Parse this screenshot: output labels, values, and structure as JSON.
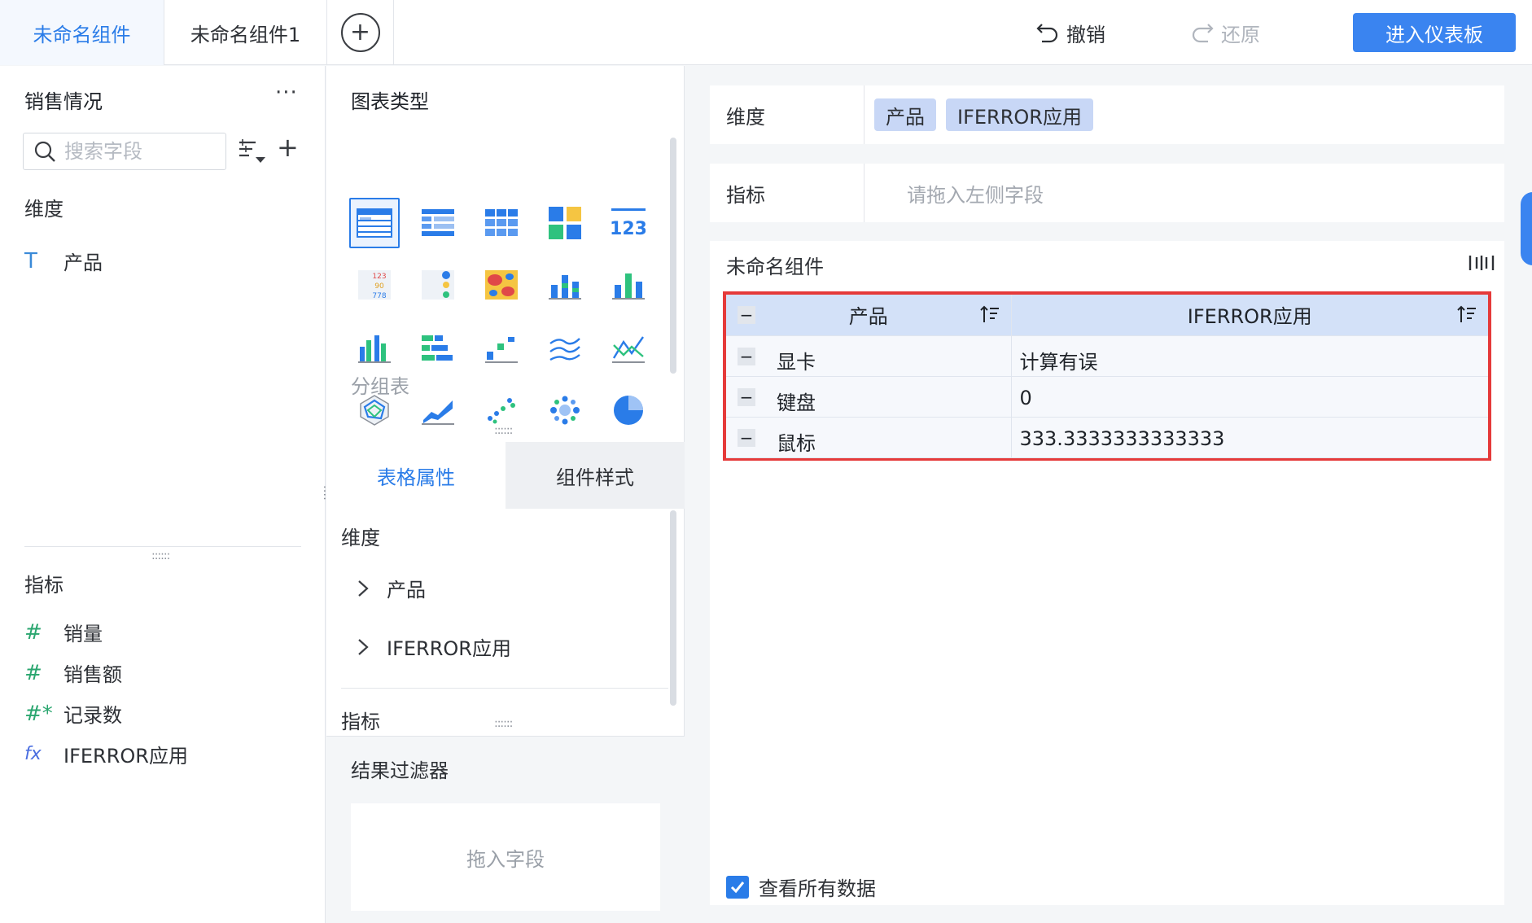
{
  "tabs": [
    {
      "label": "未命名组件",
      "active": true
    },
    {
      "label": "未命名组件1",
      "active": false
    }
  ],
  "toolbar": {
    "undo_label": "撤销",
    "redo_label": "还原",
    "enter_label": "进入仪表板"
  },
  "left_panel": {
    "dataset_title": "销售情况",
    "more": "···",
    "search_placeholder": "搜索字段",
    "dimension_label": "维度",
    "dimensions": [
      {
        "icon": "text-type-icon",
        "glyph": "T",
        "label": "产品"
      }
    ],
    "measure_label": "指标",
    "measures": [
      {
        "icon": "number-type-icon",
        "glyph": "#",
        "label": "销量"
      },
      {
        "icon": "number-type-icon",
        "glyph": "#",
        "label": "销售额"
      },
      {
        "icon": "record-count-icon",
        "glyph": "#*",
        "label": "记录数"
      },
      {
        "icon": "formula-icon",
        "glyph": "fx",
        "label": "IFERROR应用"
      }
    ]
  },
  "chart_panel": {
    "title": "图表类型",
    "group_table_label": "分组表",
    "prop_tabs": {
      "table_props": "表格属性",
      "widget_style": "组件样式"
    },
    "dimension_label": "维度",
    "dimension_items": [
      "产品",
      "IFERROR应用"
    ],
    "measure_label": "指标",
    "filter_title": "结果过滤器",
    "filter_drop": "拖入字段"
  },
  "config": {
    "dimension_label": "维度",
    "dimension_chips": [
      "产品",
      "IFERROR应用"
    ],
    "measure_label": "指标",
    "measure_placeholder": "请拖入左侧字段"
  },
  "widget": {
    "title": "未命名组件",
    "columns": [
      "产品",
      "IFERROR应用"
    ],
    "rows": [
      [
        "显卡",
        "计算有误"
      ],
      [
        "键盘",
        "0"
      ],
      [
        "鼠标",
        "333.3333333333333"
      ]
    ],
    "show_all_label": "查看所有数据",
    "show_all_checked": true
  },
  "colors": {
    "accent": "#2a7ce8",
    "button": "#3a84f0",
    "highlight_border": "#e53a3a",
    "chip": "#c8d7f6"
  }
}
